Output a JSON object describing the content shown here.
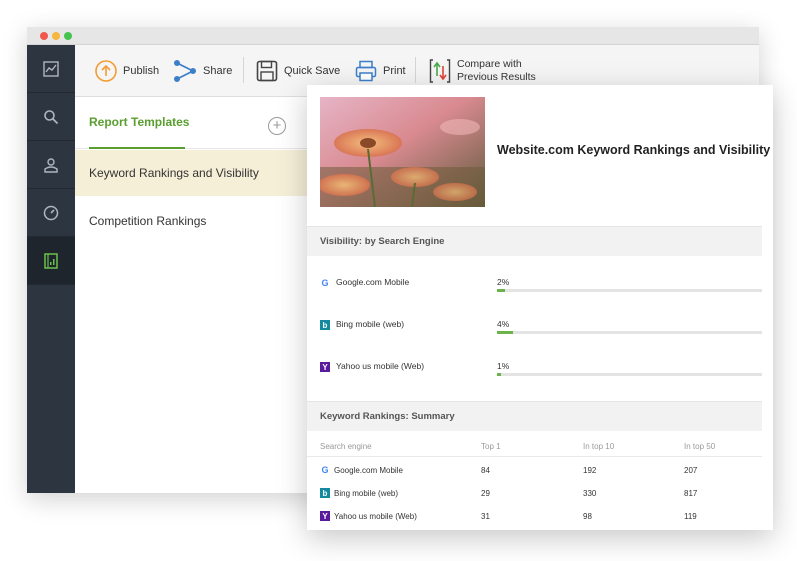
{
  "toolbar": {
    "publish": "Publish",
    "share": "Share",
    "quick_save": "Quick Save",
    "print": "Print",
    "compare_line1": "Compare with",
    "compare_line2": "Previous Results"
  },
  "templates": {
    "title": "Report Templates",
    "add_icon": "plus-circle-icon",
    "items": [
      {
        "label": "Keyword Rankings and Visibility",
        "selected": true
      },
      {
        "label": "Competition Rankings",
        "selected": false
      }
    ]
  },
  "nav": {
    "icons": [
      "chart-line-icon",
      "search-icon",
      "user-icon",
      "gauge-icon",
      "report-icon"
    ],
    "active_index": 4
  },
  "report": {
    "title": "Website.com Keyword Rankings and Visibility",
    "visibility": {
      "heading": "Visibility: by Search Engine",
      "rows": [
        {
          "engine": "Google.com Mobile",
          "icon": "google-icon",
          "percent_label": "2%",
          "value": 0.02
        },
        {
          "engine": "Bing mobile (web)",
          "icon": "bing-icon",
          "percent_label": "4%",
          "value": 0.04
        },
        {
          "engine": "Yahoo us mobile (Web)",
          "icon": "yahoo-icon",
          "percent_label": "1%",
          "value": 0.01
        }
      ]
    },
    "rankings": {
      "heading": "Keyword Rankings: Summary",
      "columns": [
        "Search engine",
        "Top 1",
        "In top 10",
        "In top 50"
      ],
      "rows": [
        {
          "engine": "Google.com Mobile",
          "icon": "google-icon",
          "top1": "84",
          "top10": "192",
          "top50": "207"
        },
        {
          "engine": "Bing mobile (web)",
          "icon": "bing-icon",
          "top1": "29",
          "top10": "330",
          "top50": "817"
        },
        {
          "engine": "Yahoo us mobile (Web)",
          "icon": "yahoo-icon",
          "top1": "31",
          "top10": "98",
          "top50": "119"
        }
      ]
    }
  },
  "colors": {
    "accent_green": "#5a9e2f",
    "nav_bg": "#2d3540",
    "selected_row": "#f6efd8",
    "publish_orange": "#f39c34",
    "share_blue": "#3c7fc9",
    "bar_green": "#6bb34a"
  }
}
